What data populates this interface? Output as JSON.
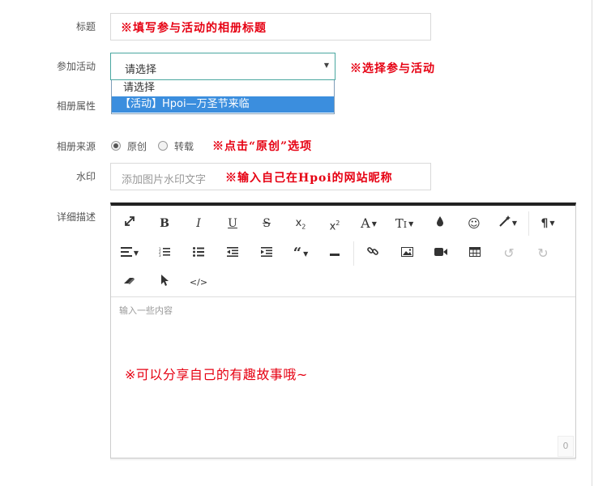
{
  "form": {
    "title": {
      "label": "标题",
      "annotation": "※填写参与活动的相册标题"
    },
    "activity": {
      "label": "参加活动",
      "selected": "请选择",
      "annotation": "※选择参与活动",
      "options": [
        "请选择",
        "【活动】Hpoi—万圣节来临"
      ]
    },
    "album_attr": {
      "label": "相册属性"
    },
    "source": {
      "label": "相册来源",
      "options": [
        "原创",
        "转载"
      ],
      "selected": "原创",
      "annotation": "※点击“原创”选项"
    },
    "watermark": {
      "label": "水印",
      "placeholder": "添加图片水印文字",
      "annotation": "※输入自己在Hpoi的网站昵称"
    },
    "description": {
      "label": "详细描述",
      "placeholder": "输入一些内容",
      "annotation": "※可以分享自己的有趣故事哦~",
      "char_count": "0"
    }
  },
  "toolbar": {
    "icons": [
      "fullscreen-icon",
      "bold-icon",
      "italic-icon",
      "underline-icon",
      "strikethrough-icon",
      "subscript-icon",
      "superscript-icon",
      "font-size-icon",
      "paragraph-size-icon",
      "color-icon",
      "emoji-icon",
      "magic-icon",
      "paragraph-format-icon",
      "align-icon",
      "ordered-list-icon",
      "unordered-list-icon",
      "outdent-icon",
      "indent-icon",
      "quote-icon",
      "horizontal-line-icon",
      "link-icon",
      "image-icon",
      "video-icon",
      "table-icon",
      "undo-icon",
      "redo-icon",
      "eraser-icon",
      "select-all-icon",
      "code-view-icon"
    ]
  }
}
